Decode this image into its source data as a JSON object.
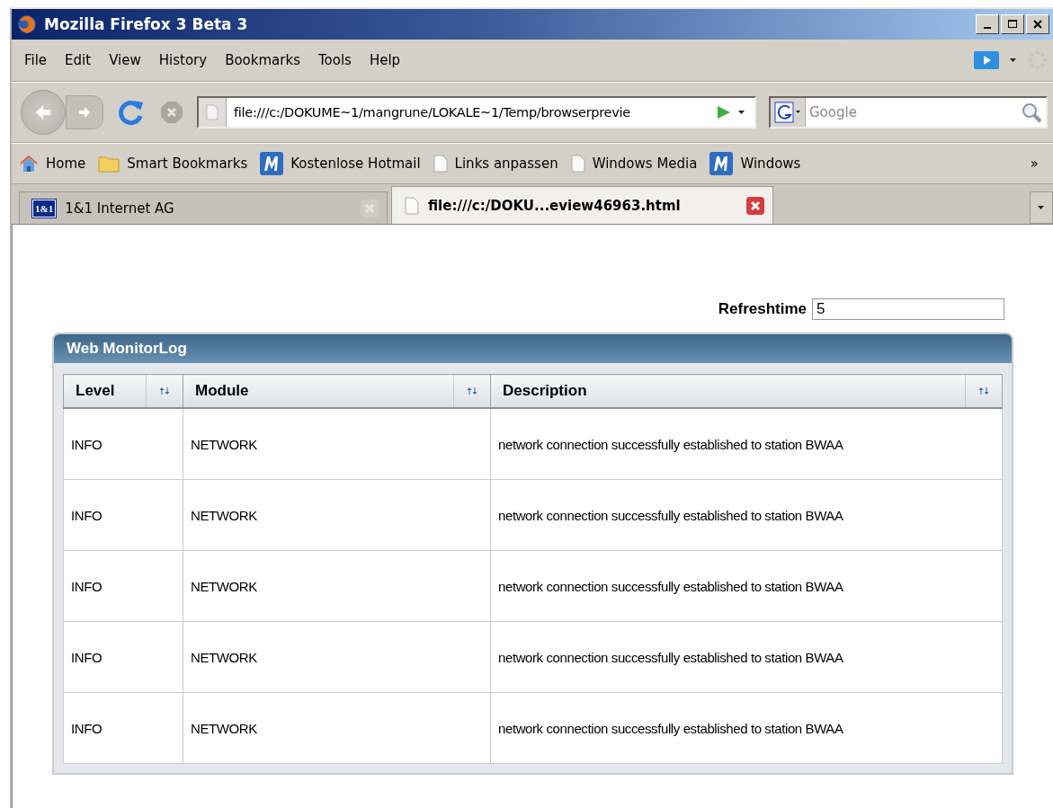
{
  "window": {
    "title": "Mozilla Firefox 3 Beta 3"
  },
  "menu": [
    "File",
    "Edit",
    "View",
    "History",
    "Bookmarks",
    "Tools",
    "Help"
  ],
  "address": {
    "value": "file:///c:/DOKUME~1/mangrune/LOKALE~1/Temp/browserprevie"
  },
  "search": {
    "placeholder": "Google"
  },
  "bookmarks": [
    {
      "label": "Home",
      "kind": "home"
    },
    {
      "label": "Smart Bookmarks",
      "kind": "folder"
    },
    {
      "label": "Kostenlose Hotmail",
      "kind": "m"
    },
    {
      "label": "Links anpassen",
      "kind": "page"
    },
    {
      "label": "Windows Media",
      "kind": "page"
    },
    {
      "label": "Windows",
      "kind": "m"
    }
  ],
  "bookmarks_overflow": "»",
  "tabs": [
    {
      "label": "1&1 Internet AG",
      "selected": false,
      "kind": "brand",
      "badge": "1&1"
    },
    {
      "label": "file:///c:/DOKU...eview46963.html",
      "selected": true,
      "kind": "page"
    }
  ],
  "refresh": {
    "label": "Refreshtime",
    "value": "5"
  },
  "panel": {
    "title": "Web MonitorLog"
  },
  "table": {
    "columns": [
      "Level",
      "Module",
      "Description"
    ],
    "rows": [
      [
        "INFO",
        "NETWORK",
        "network connection successfully established to station BWAA"
      ],
      [
        "INFO",
        "NETWORK",
        "network connection successfully established to station BWAA"
      ],
      [
        "INFO",
        "NETWORK",
        "network connection successfully established to station BWAA"
      ],
      [
        "INFO",
        "NETWORK",
        "network connection successfully established to station BWAA"
      ],
      [
        "INFO",
        "NETWORK",
        "network connection successfully established to station BWAA"
      ]
    ]
  }
}
